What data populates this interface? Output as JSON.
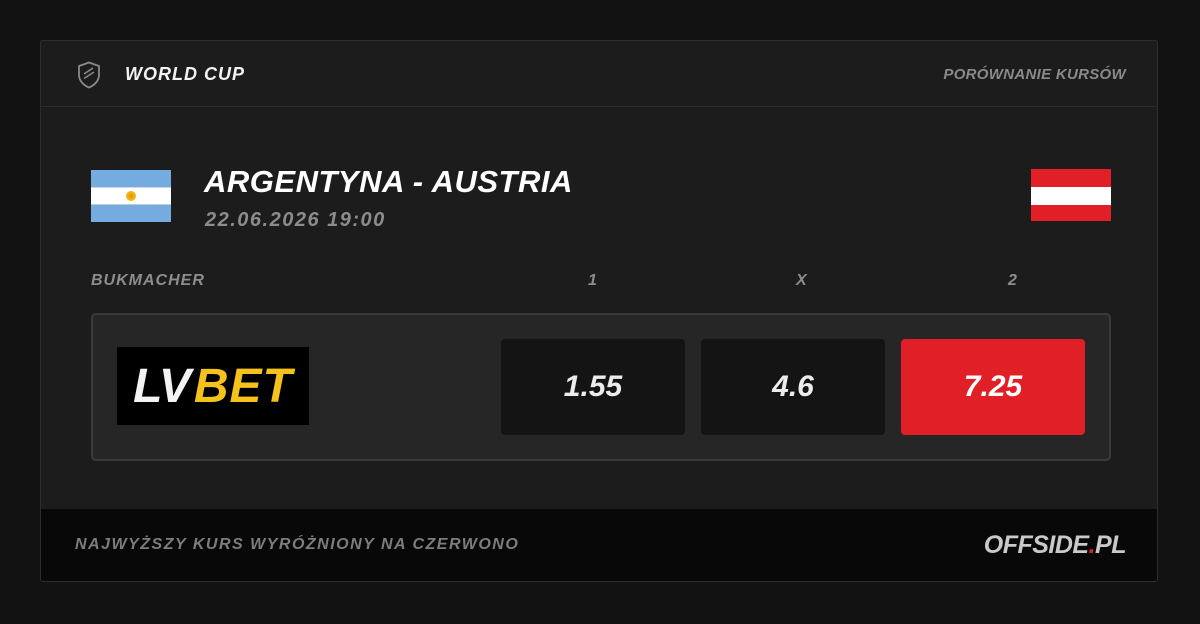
{
  "header": {
    "competition": "WORLD CUP",
    "section": "PORÓWNANIE KURSÓW"
  },
  "match": {
    "title": "ARGENTYNA - AUSTRIA",
    "date": "22.06.2026 19:00",
    "home_flag": "argentina-flag",
    "away_flag": "austria-flag"
  },
  "columns": {
    "bookmaker": "BUKMACHER",
    "home": "1",
    "draw": "X",
    "away": "2"
  },
  "bookmakers": [
    {
      "logo_text_1": "LV",
      "logo_text_2": "BET",
      "odds": {
        "home": "1.55",
        "draw": "4.6",
        "away": "7.25"
      },
      "highlighted": "away"
    }
  ],
  "footer": {
    "note": "NAJWYŻSZY KURS WYRÓŻNIONY NA CZERWONO",
    "brand_main": "OFFSIDE",
    "brand_dot": ".",
    "brand_suffix": "PL"
  },
  "colors": {
    "highlight": "#e01f26",
    "background": "#1c1c1c",
    "lvbet_yellow": "#f4c21b"
  },
  "icons": {
    "competition": "shield-icon"
  }
}
